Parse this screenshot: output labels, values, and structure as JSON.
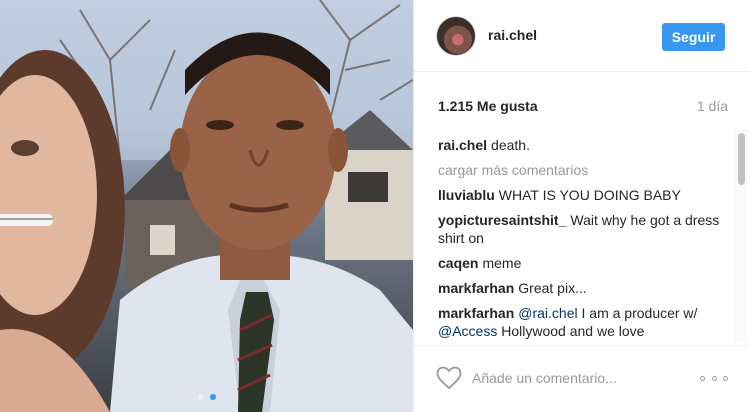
{
  "post": {
    "username": "rai.chel",
    "follow_label": "Seguir",
    "likes": "1.215 Me gusta",
    "time": "1 día",
    "caption": {
      "user": "rai.chel",
      "text": "death."
    },
    "load_more": "cargar más comentarios",
    "comments": [
      {
        "user": "lluviablu",
        "text": "WHAT IS YOU DOING BABY"
      },
      {
        "user": "yopicturesaintshit_",
        "text": "Wait why he got a dress shirt on"
      },
      {
        "user": "caqen",
        "text": "meme"
      },
      {
        "user": "markfarhan",
        "text": "Great pix..."
      },
      {
        "user": "markfarhan",
        "mention1": "@rai.chel",
        "text_mid": " I am a producer w/ ",
        "mention2": "@Access",
        "text_end": " Hollywood and we love"
      }
    ],
    "add_comment_placeholder": "Añade un comentario...",
    "carousel": {
      "count": 2,
      "active_index": 1
    },
    "icons": {
      "like": "heart-icon",
      "options": "more-options-icon"
    },
    "colors": {
      "accent": "#3897f0",
      "muted": "#999999",
      "text": "#262626"
    }
  }
}
